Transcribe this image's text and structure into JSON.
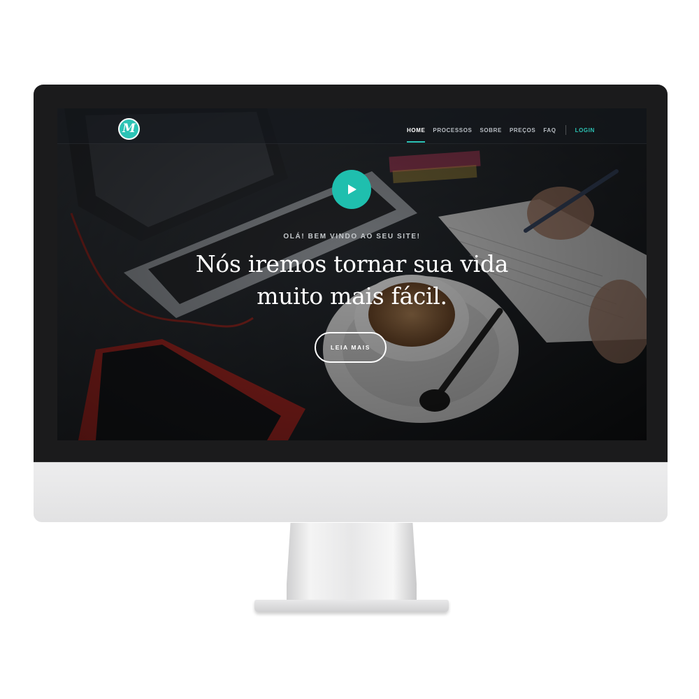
{
  "brand": {
    "logo_letter": "M"
  },
  "nav": {
    "items": [
      {
        "label": "HOME",
        "active": true
      },
      {
        "label": "PROCESSOS",
        "active": false
      },
      {
        "label": "SOBRE",
        "active": false
      },
      {
        "label": "PREÇOS",
        "active": false
      },
      {
        "label": "FAQ",
        "active": false
      }
    ],
    "login_label": "LOGIN"
  },
  "hero": {
    "eyebrow": "OLÁ! BEM VINDO AO SEU SITE!",
    "headline_line1": "Nós iremos tornar sua vida",
    "headline_line2": "muito mais fácil.",
    "cta_label": "LEIA MAIS",
    "play_icon": "play-icon"
  },
  "colors": {
    "accent": "#2cc3b5",
    "bezel": "#1b1b1c",
    "chin": "#e7e7e8",
    "text": "#ffffff"
  }
}
